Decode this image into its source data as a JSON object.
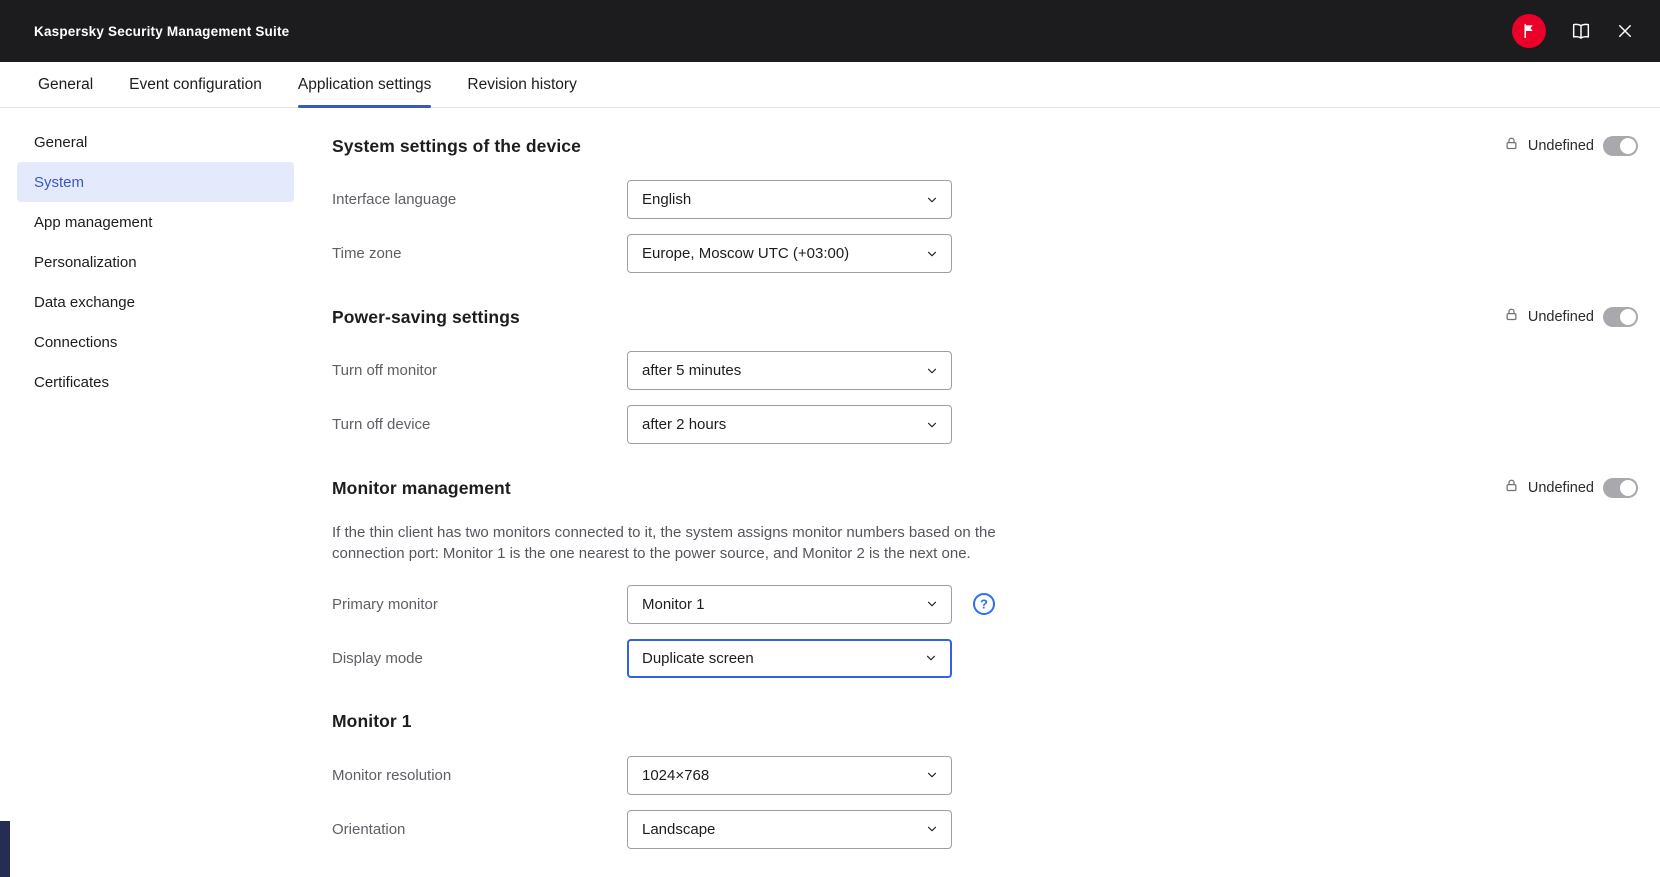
{
  "window": {
    "title": "Kaspersky Security Management Suite"
  },
  "titlebar": {
    "icons": [
      "flag-icon",
      "book-icon",
      "close-icon"
    ]
  },
  "tabs": [
    {
      "label": "General",
      "active": false
    },
    {
      "label": "Event configuration",
      "active": false
    },
    {
      "label": "Application settings",
      "active": true
    },
    {
      "label": "Revision history",
      "active": false
    }
  ],
  "sidebar": {
    "items": [
      "General",
      "System",
      "App management",
      "Personalization",
      "Data exchange",
      "Connections",
      "Certificates"
    ],
    "active": "System"
  },
  "sections": [
    {
      "title": "System settings of the device",
      "lock_label": "Undefined",
      "rows": [
        {
          "label": "Interface language",
          "value": "English"
        },
        {
          "label": "Time zone",
          "value": "Europe, Moscow UTC (+03:00)"
        }
      ]
    },
    {
      "title": "Power-saving settings",
      "lock_label": "Undefined",
      "rows": [
        {
          "label": "Turn off monitor",
          "value": "after 5 minutes"
        },
        {
          "label": "Turn off device",
          "value": "after 2 hours"
        }
      ]
    },
    {
      "title": "Monitor management",
      "lock_label": "Undefined",
      "description": "If the thin client has two monitors connected to it, the system assigns monitor numbers based on the connection port: Monitor 1 is the one nearest to the power source, and Monitor 2 is the next one.",
      "rows": [
        {
          "label": "Primary monitor",
          "value": "Monitor 1",
          "help": true
        },
        {
          "label": "Display mode",
          "value": "Duplicate screen",
          "focused": true
        }
      ]
    },
    {
      "title": "Monitor 1",
      "rows": [
        {
          "label": "Monitor resolution",
          "value": "1024×768"
        },
        {
          "label": "Orientation",
          "value": "Landscape"
        }
      ]
    }
  ],
  "colors": {
    "accent": "#3A57C4",
    "focus_blue": "#3560E2",
    "brand_red": "#EB0029",
    "header_bg": "#1C1C1E",
    "sidebar_selected_bg": "#E4EAFB",
    "toggle_track": "#A9A9AD"
  }
}
